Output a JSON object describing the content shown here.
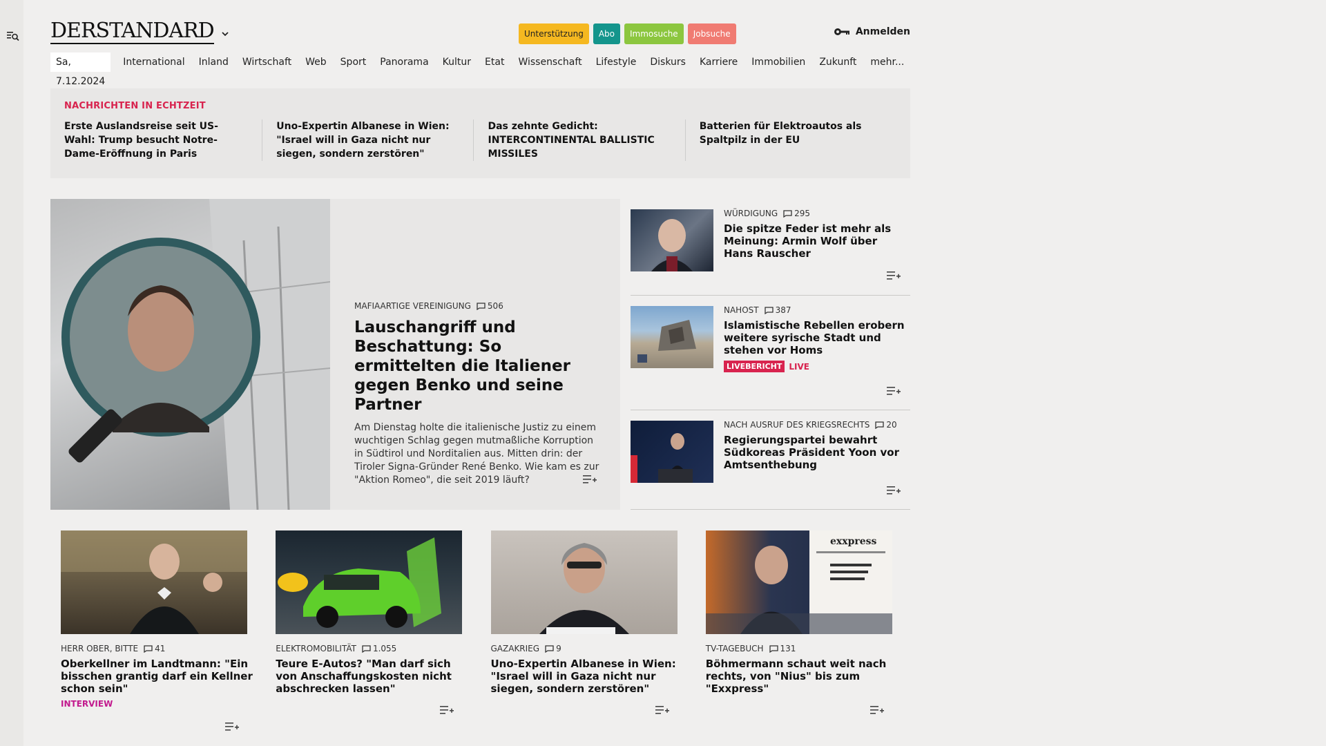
{
  "site": {
    "logo": "DERSTANDARD",
    "pills": [
      {
        "label": "Unterstützung",
        "color": "#f5b820",
        "text": "#222"
      },
      {
        "label": "Abo",
        "color": "#14958c",
        "text": "#fff"
      },
      {
        "label": "Immosuche",
        "color": "#8cc63f",
        "text": "#fff"
      },
      {
        "label": "Jobsuche",
        "color": "#f07b72",
        "text": "#fff"
      }
    ],
    "login": "Anmelden"
  },
  "nav": {
    "date": "Sa, 7.12.2024",
    "items": [
      "International",
      "Inland",
      "Wirtschaft",
      "Web",
      "Sport",
      "Panorama",
      "Kultur",
      "Etat",
      "Wissenschaft",
      "Lifestyle",
      "Diskurs",
      "Karriere",
      "Immobilien",
      "Zukunft",
      "mehr..."
    ]
  },
  "realtime": {
    "label": "NACHRICHTEN IN ECHTZEIT",
    "items": [
      "Erste Auslandsreise seit US-Wahl: Trump besucht Notre-Dame-Eröff­nung in Paris",
      "Uno-Expertin Albanese in Wien: \"Is­rael will in Gaza nicht nur siegen, son­dern zerstören\"",
      "Das zehnte Gedicht: INTERCONTINEN­TAL BALLISTIC MISSILES",
      "Batterien für Elektroautos als Spalt­pilz in der EU"
    ]
  },
  "hero": {
    "kicker": "MAFIAARTIGE VEREINIGUNG",
    "comments": "506",
    "title": "Lauschangriff und Beschattung: So ermittelten die Italiener gegen Benko und seine Partner",
    "lead": "Am Dienstag holte die italienische Justiz zu einem wuchtigen Schlag gegen mutmaßliche Korruption in Südtirol und Norditalien aus. Mitten drin: der Tiroler Signa-Gründer René Benko. Wie kam es zur \"Aktion Romeo\", die seit 2019 läuft?"
  },
  "side": [
    {
      "kicker": "WÜRDIGUNG",
      "comments": "295",
      "title": "Die spitze Feder ist mehr als Meinung: Armin Wolf über Hans Rauscher"
    },
    {
      "kicker": "NAHOST",
      "comments": "387",
      "title": "Islamistische Rebellen erobern weitere syrische Stadt und stehen vor Homs",
      "badge": "LIVEBERICHT",
      "badge2": "LIVE"
    },
    {
      "kicker": "NACH AUSRUF DES KRIEGSRECHTS",
      "comments": "20",
      "title": "Regierungspartei bewahrt Südkoreas Präsident Yoon vor Amtsenthebung"
    }
  ],
  "cards": [
    {
      "kicker": "HERR OBER, BITTE",
      "comments": "41",
      "title": "Oberkellner im Landtmann: \"Ein bisschen grantig darf ein Kellner schon sein\"",
      "tag": "INTERVIEW"
    },
    {
      "kicker": "ELEKTROMOBILITÄT",
      "comments": "1.055",
      "title": "Teure E-Autos? \"Man darf sich von Anschaffungskosten nicht abschrecken lassen\""
    },
    {
      "kicker": "GAZAKRIEG",
      "comments": "9",
      "title": "Uno-Expertin Albanese in Wien: \"Israel will in Gaza nicht nur siegen, sondern zerstören\""
    },
    {
      "kicker": "TV-TAGEBUCH",
      "comments": "131",
      "title": "Böhmermann schaut weit nach rechts, von \"Nius\" bis zum \"Exxpress\"",
      "img_text": "exxpress"
    }
  ]
}
